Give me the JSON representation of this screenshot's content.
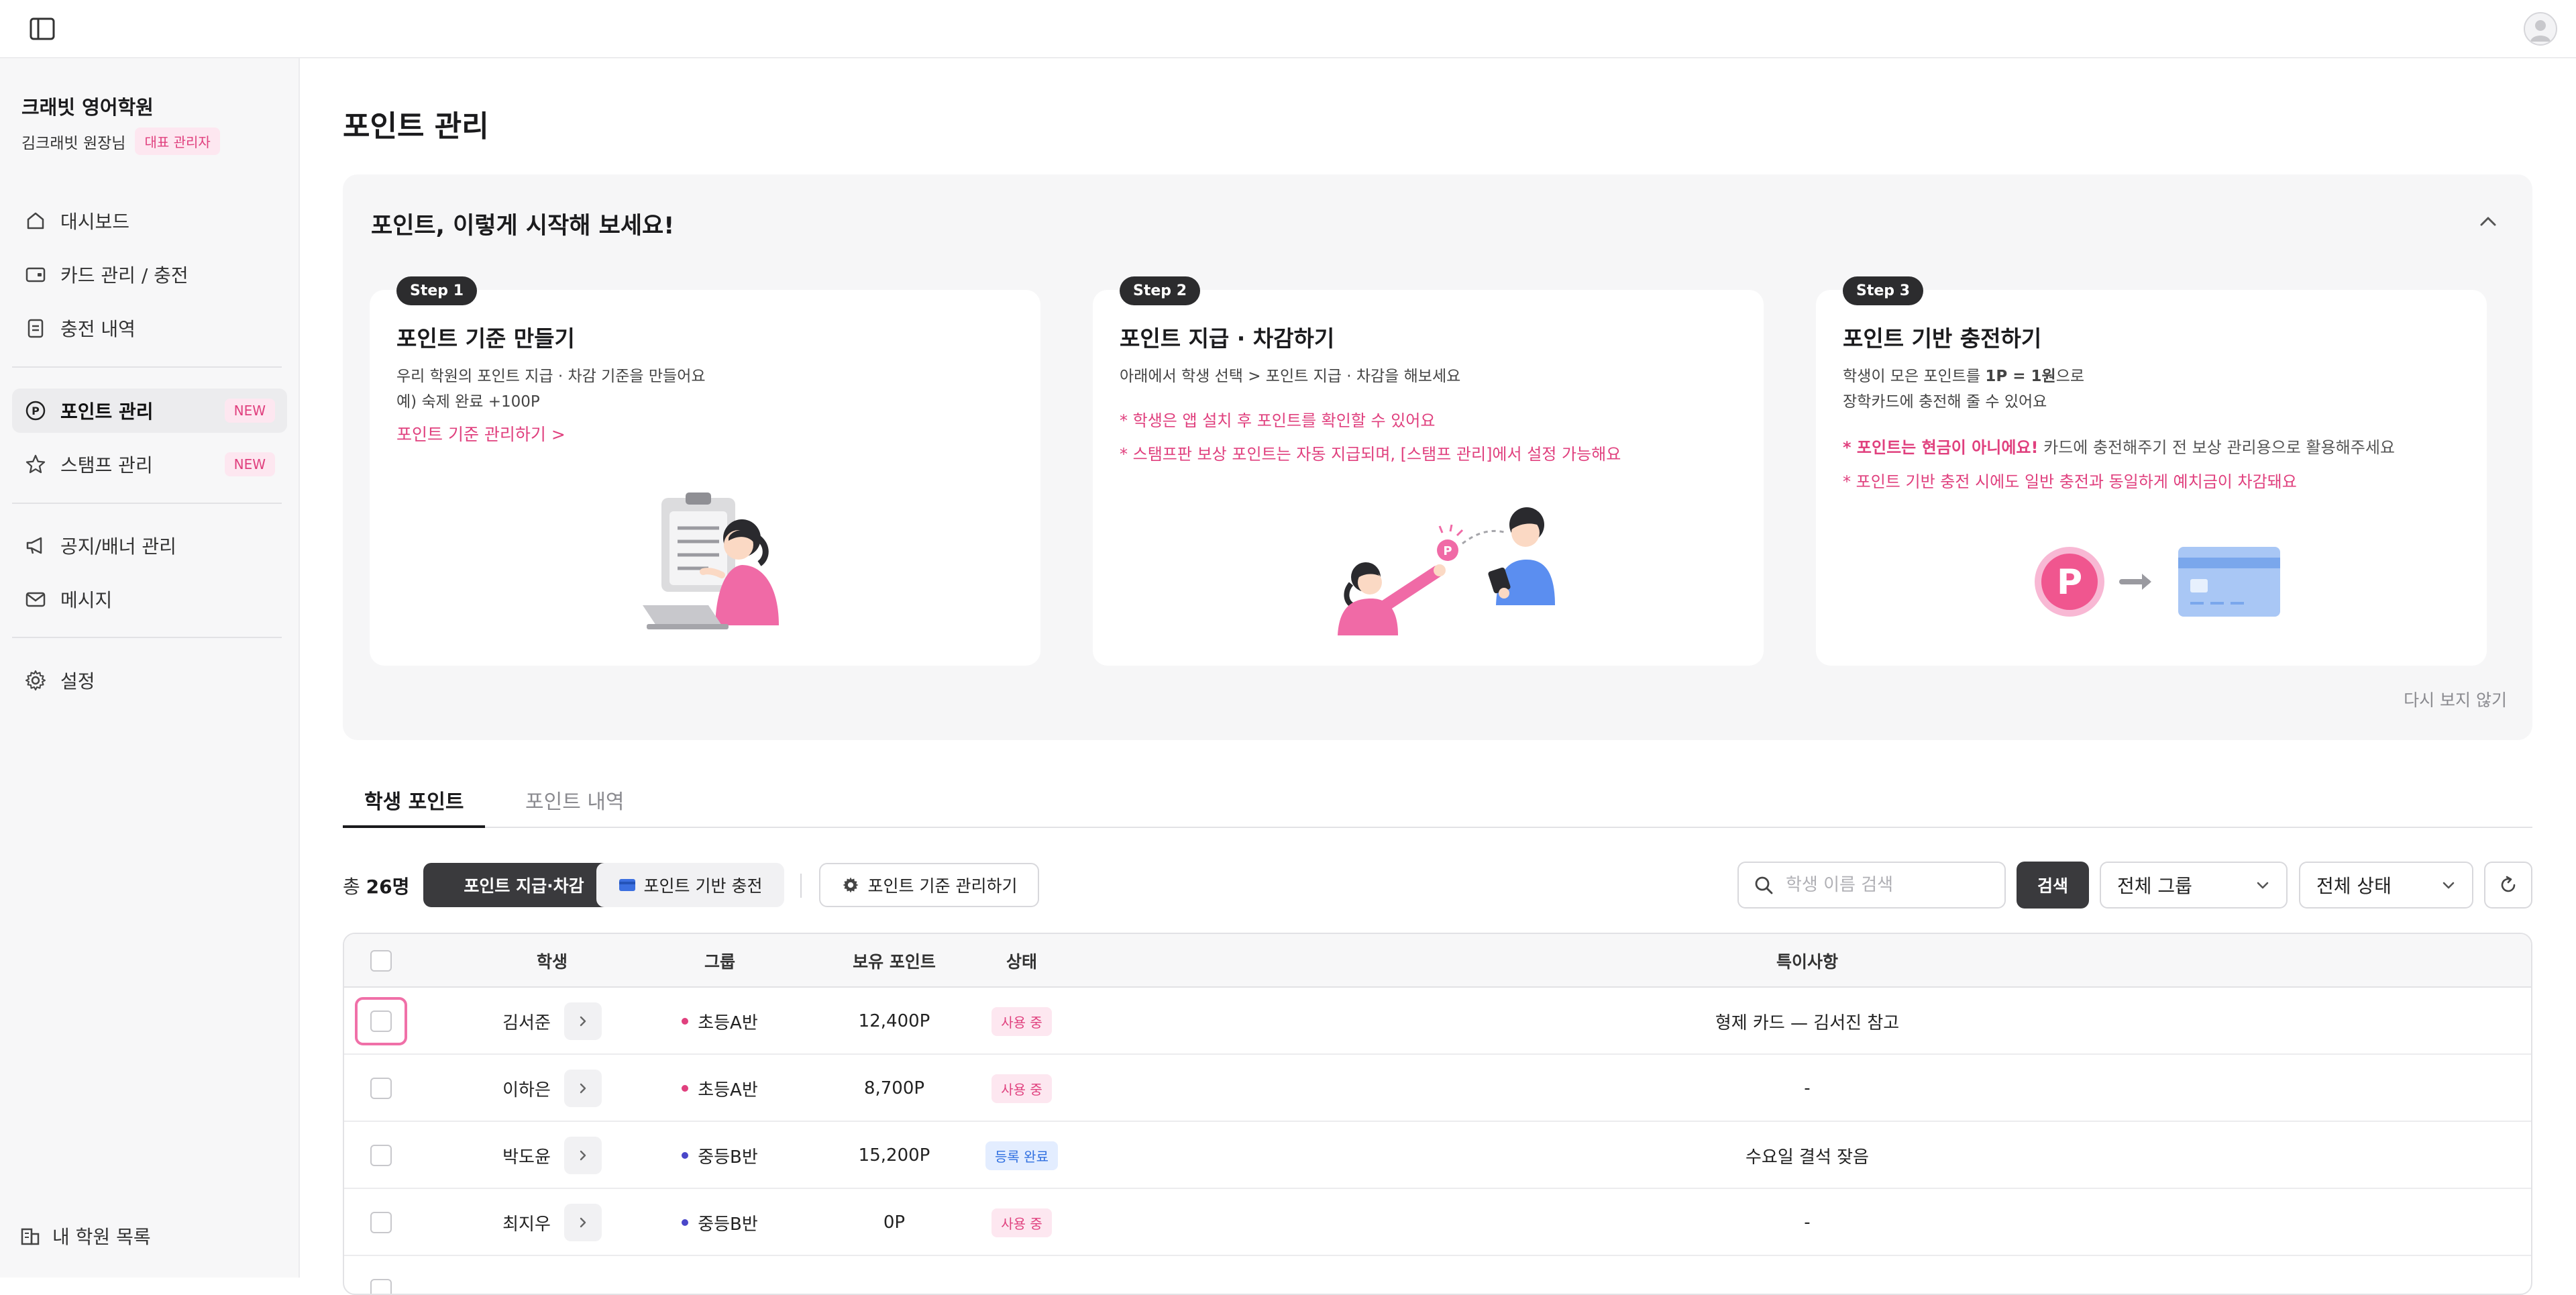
{
  "colors": {
    "accent_pink": "#e0407e",
    "dark": "#3a3a3d",
    "blue_status": "#2f6fe0",
    "indigo_dot": "#4a47c9"
  },
  "sidebar": {
    "academy": "크래빗 영어학원",
    "user": "김크래빗 원장님",
    "role": "대표 관리자",
    "items": [
      {
        "label": "대시보드",
        "icon": "home-icon"
      },
      {
        "label": "카드 관리 / 충전",
        "icon": "card-icon"
      },
      {
        "label": "충전 내역",
        "icon": "document-icon"
      },
      {
        "label": "포인트 관리",
        "icon": "point-icon",
        "badge": "NEW",
        "active": true
      },
      {
        "label": "스탬프 관리",
        "icon": "star-icon",
        "badge": "NEW"
      },
      {
        "label": "공지/배너 관리",
        "icon": "megaphone-icon"
      },
      {
        "label": "메시지",
        "icon": "mail-icon"
      },
      {
        "label": "설정",
        "icon": "gear-icon"
      }
    ],
    "bottom_link": "내 학원 목록"
  },
  "page": {
    "title": "포인트 관리"
  },
  "guide": {
    "title": "포인트, 이렇게 시작해 보세요!",
    "dont_show": "다시 보지 않기",
    "steps": [
      {
        "badge": "Step 1",
        "title": "포인트 기준 만들기",
        "desc1": "우리 학원의 포인트 지급 · 차감 기준을 만들어요",
        "desc2": "예) 숙제 완료 +100P",
        "link": "포인트 기준 관리하기 >"
      },
      {
        "badge": "Step 2",
        "title": "포인트 지급 · 차감하기",
        "desc1": "아래에서 학생 선택 > 포인트 지급 · 차감을 해보세요",
        "note1": "* 학생은 앱 설치 후 포인트를 확인할 수 있어요",
        "note2": "* 스탬프판 보상 포인트는 자동 지급되며, [스탬프 관리]에서 설정 가능해요"
      },
      {
        "badge": "Step 3",
        "title": "포인트 기반 충전하기",
        "desc1_pre": "학생이 모은 포인트를 ",
        "desc1_bold": "1P = 1원",
        "desc1_post": "으로",
        "desc2": "장학카드에 충전해 줄 수 있어요",
        "note1_bold": "* 포인트는 현금이 아니에요!",
        "note1_rest": " 카드에 충전해주기 전 보상 관리용으로 활용해주세요",
        "note2": "* 포인트 기반 충전 시에도 일반 충전과 동일하게 예치금이 차감돼요",
        "point_symbol": "P"
      }
    ]
  },
  "tabs": [
    {
      "label": "학생 포인트",
      "active": true
    },
    {
      "label": "포인트 내역",
      "active": false
    }
  ],
  "toolbar": {
    "total_prefix": "총",
    "total_count": "26명",
    "give_btn": "포인트 지급·차감",
    "charge_btn": "포인트 기반 충전",
    "criteria_btn": "포인트 기준 관리하기",
    "search_placeholder": "학생 이름 검색",
    "search_btn": "검색",
    "group_select": "전체 그룹",
    "status_select": "전체 상태"
  },
  "table": {
    "headers": {
      "student": "학생",
      "group": "그룹",
      "points": "보유 포인트",
      "status": "상태",
      "note": "특이사항"
    },
    "rows": [
      {
        "name": "김서준",
        "group": "초등A반",
        "group_color": "#e0407e",
        "points": "12,400P",
        "status": "사용 중",
        "status_type": "use",
        "note": "형제 카드 — 김서진 참고"
      },
      {
        "name": "이하은",
        "group": "초등A반",
        "group_color": "#e0407e",
        "points": "8,700P",
        "status": "사용 중",
        "status_type": "use",
        "note": "-"
      },
      {
        "name": "박도윤",
        "group": "중등B반",
        "group_color": "#4a47c9",
        "points": "15,200P",
        "status": "등록 완료",
        "status_type": "done",
        "note": "수요일 결석 잦음"
      },
      {
        "name": "최지우",
        "group": "중등B반",
        "group_color": "#4a47c9",
        "points": "0P",
        "status": "사용 중",
        "status_type": "use",
        "note": "-"
      }
    ]
  }
}
